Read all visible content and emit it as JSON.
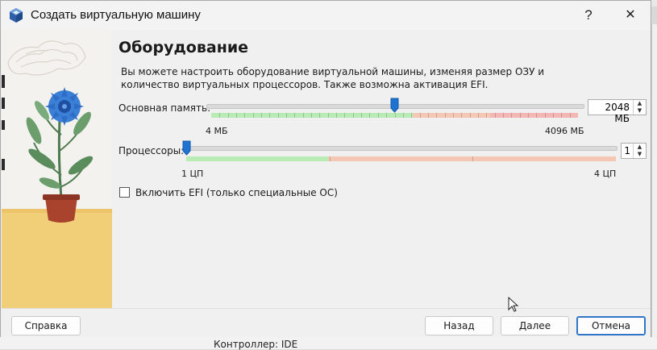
{
  "window": {
    "title": "Создать виртуальную машину",
    "help_glyph": "?",
    "close_glyph": "✕"
  },
  "page": {
    "heading": "Оборудование",
    "description": "Вы можете настроить оборудование виртуальной машины, изменяя размер ОЗУ и количество виртуальных процессоров. Также возможна активация EFI."
  },
  "memory": {
    "label": "Основная память:",
    "value": "2048 МБ",
    "value_mb": 2048,
    "min_label": "4 МБ",
    "max_label": "4096 МБ",
    "min_mb": 4,
    "max_mb": 4096
  },
  "processors": {
    "label": "Процессоры:",
    "value": "1",
    "min_label": "1 ЦП",
    "max_label": "4 ЦП",
    "min": 1,
    "max": 4
  },
  "efi": {
    "label": "Включить EFI (только специальные ОС)",
    "checked": false
  },
  "buttons": {
    "help": "Справка",
    "back": "Назад",
    "next": "Далее",
    "cancel": "Отмена"
  },
  "background": {
    "bottom_text": "Контроллер: IDE"
  },
  "colors": {
    "accent": "#2f76c8",
    "thumb": "#1e73d2",
    "scale_green": "#b9ebb5",
    "scale_orange": "#f5c8b5",
    "scale_red": "#f5b6b6"
  },
  "icons": {
    "app": "virtualbox-icon",
    "spin_up": "▲",
    "spin_down": "▼"
  }
}
